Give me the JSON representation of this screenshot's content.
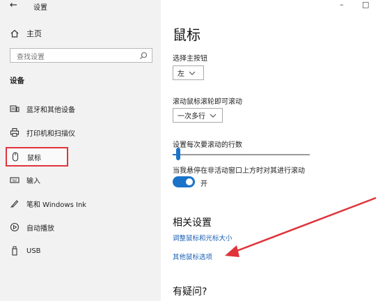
{
  "window": {
    "back_glyph": "←",
    "title": "设置",
    "minimize_glyph": "–",
    "maximize_glyph": "□"
  },
  "sidebar": {
    "home_label": "主页",
    "search_placeholder": "查找设置",
    "section_title": "设备",
    "items": [
      {
        "label": "蓝牙和其他设备",
        "icon": "bluetooth-devices-icon"
      },
      {
        "label": "打印机和扫描仪",
        "icon": "printer-icon"
      },
      {
        "label": "鼠标",
        "icon": "mouse-icon",
        "selected": true
      },
      {
        "label": "输入",
        "icon": "keyboard-icon"
      },
      {
        "label": "笔和 Windows Ink",
        "icon": "pen-icon"
      },
      {
        "label": "自动播放",
        "icon": "autoplay-icon"
      },
      {
        "label": "USB",
        "icon": "usb-icon"
      }
    ]
  },
  "main": {
    "title": "鼠标",
    "primary_button": {
      "label": "选择主按钮",
      "value": "左"
    },
    "scroll_setting": {
      "label": "滚动鼠标滚轮即可滚动",
      "value": "一次多行"
    },
    "lines_to_scroll": {
      "label": "设置每次要滚动的行数",
      "value_fraction": 0.04
    },
    "inactive_scroll": {
      "label": "当我悬停在非活动窗口上方时对其进行滚动",
      "state_label": "开",
      "on": true
    },
    "related": {
      "heading": "相关设置",
      "links": [
        "调整鼠标和光标大小",
        "其他鼠标选项"
      ]
    },
    "question_heading": "有疑问?"
  },
  "colors": {
    "accent": "#1a73c8",
    "highlight_box": "#e0333b",
    "arrow": "#e0333b"
  }
}
